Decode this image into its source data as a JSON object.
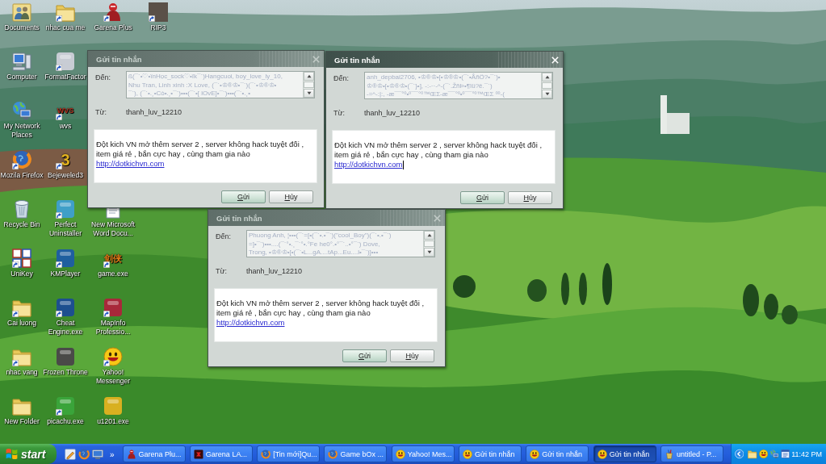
{
  "desktop": {
    "columns": [
      {
        "upper": [
          {
            "label": "Documents",
            "kind": "people-folder",
            "shortcut": false
          },
          {
            "label": "Computer",
            "kind": "computer",
            "shortcut": false
          },
          {
            "label": "My Network Places",
            "kind": "network",
            "shortcut": false
          },
          {
            "label": "Mozila Firefox",
            "kind": "globe",
            "shortcut": true
          },
          {
            "label": "Recycle Bin",
            "kind": "bin",
            "shortcut": false
          },
          {
            "label": "UniKey",
            "kind": "grid",
            "shortcut": true
          },
          {
            "label": "Cai luong",
            "kind": "folder",
            "shortcut": true
          },
          {
            "label": "nhac vang",
            "kind": "folder",
            "shortcut": true
          },
          {
            "label": "New Folder",
            "kind": "folder",
            "shortcut": false
          }
        ]
      },
      {
        "upper": [
          {
            "label": "nhac cua me",
            "kind": "folder",
            "shortcut": true
          },
          {
            "label": "FormatFactor",
            "kind": "app",
            "color": "#c8ccd4",
            "shortcut": true
          },
          {
            "label": "wvs",
            "kind": "glyph",
            "glyph": "WVS",
            "color": "#b0301e",
            "shortcut": true
          },
          {
            "label": "Bejeweled3",
            "kind": "glyph",
            "glyph": "3",
            "color": "#e0b020",
            "shortcut": true
          },
          {
            "label": "Perfect Uninstaller",
            "kind": "app",
            "color": "#3f9fc8",
            "shortcut": true
          },
          {
            "label": "KMPlayer",
            "kind": "app",
            "color": "#1f5f9f",
            "shortcut": true
          },
          {
            "label": "Cheat Engine.exe",
            "kind": "app",
            "color": "#1d4f8f",
            "shortcut": true
          },
          {
            "label": "Frozen Throne",
            "kind": "app",
            "color": "#4a4a48",
            "shortcut": false
          },
          {
            "label": "picachu.exe",
            "kind": "app",
            "color": "#3aa43a",
            "shortcut": true
          }
        ]
      },
      {
        "upper": [
          {
            "label": "Garena Plus",
            "kind": "figure",
            "shortcut": true
          }
        ],
        "lower": [
          {
            "label": "New Microsoft Word Docu...",
            "kind": "document",
            "shortcut": false
          },
          {
            "label": "game.exe",
            "kind": "glyph",
            "glyph": "剑侠",
            "color": "#e07818",
            "shortcut": true
          },
          {
            "label": "MapInfo Professio...",
            "kind": "app",
            "color": "#a8283a",
            "shortcut": true
          },
          {
            "label": "Yahoo! Messenger",
            "kind": "smiley",
            "shortcut": true
          },
          {
            "label": "u1201.exe",
            "kind": "app",
            "color": "#d8b020",
            "shortcut": false
          }
        ]
      },
      {
        "upper": [
          {
            "label": "RIP3",
            "kind": "photo",
            "shortcut": true
          }
        ]
      }
    ]
  },
  "windows": [
    {
      "title": "Gửi tin nhắn",
      "active": false,
      "to_label": "Đến:",
      "recipients": {
        "text": "ß(¯`•♡•ïnHọc_sock♡•ïk¯`)Hangcuoi, boy_love_ly_10,\nNhu Tran, Linh xinh :X Love, (¯`•♔®♔•¯`)(¯`•♔®♔•\n¯`), (¯`•.¸•Cò•.¸•¯`)•••(¯`•[ lOvE]•¯`)•••(¯`•.¸•",
        "disabled": true
      },
      "from_label": "Từ:",
      "sender": "thanh_luv_12210",
      "message": "Đột kich VN mở thêm server 2 , server không hack tuyệt đối ,\nitem giá rẻ , bắn cực hay , cùng tham gia nào",
      "link": "http://dotkichvn.com",
      "caret": false,
      "buttons": [
        {
          "label": "Gửi",
          "default": true
        },
        {
          "label": "Hủy",
          "default": false
        }
      ]
    },
    {
      "title": "Gửi tin nhắn",
      "active": true,
      "to_label": "Đến:",
      "recipients": {
        "text": "anh_depbai2706, •♔®♔•[•♔®♔•(¯`•ÅñÖ?•¯`)•\n♔®♔•[•♔®♔•(¯`}•], -:-··-^-(¯`.ŽñÞ•¶ïü?ë.¯`)\n-=^-:|:, -æ¯¯°º•º¯¯°º™ŒΣ-æ¯¯°º•º¯¯°º™ŒΣ ºº-(",
        "disabled": true
      },
      "from_label": "Từ:",
      "sender": "thanh_luv_12210",
      "message": "Đột kich VN mở thêm server 2 , server không hack tuyệt đối ,\nitem giá rẻ , bắn cực hay , cùng tham gia nào",
      "link": "http://dotkichvn.com",
      "caret": true,
      "buttons": [
        {
          "label": "Gửi",
          "default": true
        },
        {
          "label": "Hủy",
          "default": false
        }
      ]
    },
    {
      "title": "Gửi tin nhắn",
      "active": false,
      "to_label": "Đến:",
      "recipients": {
        "text": "Phuong Anh, ¦•••(¯`=[•(¯`•.•¯`)(\"cool_Boy\")(¯`•.•¯`)\n=]•¯`)•••....(¯`°•.¸¯`°•.°Fe he0°.•°¯`..•°¯`) Dove,\nTrong, •♔®♔•[•(¯`•L...gA....tAp...Eu....l•¯`)]•••",
        "disabled": true
      },
      "from_label": "Từ:",
      "sender": "thanh_luv_12210",
      "message": "Đột kich VN mở thêm server 2 , server không hack tuyệt đối ,\nitem giá rẻ , bắn cực hay , cùng tham gia nào",
      "link": "http://dotkichvn.com",
      "caret": false,
      "buttons": [
        {
          "label": "Gửi",
          "default": true
        },
        {
          "label": "Hủy",
          "default": false
        }
      ]
    }
  ],
  "taskbar": {
    "start": "start",
    "quick_launch": [
      {
        "kind": "pencil"
      },
      {
        "kind": "globe"
      },
      {
        "kind": "monitor"
      }
    ],
    "overflow": "»",
    "tasks": [
      {
        "label": "Garena Plu...",
        "kind": "figure",
        "selected": false
      },
      {
        "label": "Garena LA...",
        "kind": "game",
        "selected": false
      },
      {
        "label": "[Tin mới]Qu...",
        "kind": "globe",
        "selected": false
      },
      {
        "label": "Game bOx ...",
        "kind": "globe",
        "selected": false
      },
      {
        "label": "Yahoo! Mes...",
        "kind": "smiley",
        "selected": false
      },
      {
        "label": "Gửi tin nhắn",
        "kind": "smiley",
        "selected": false
      },
      {
        "label": "Gửi tin nhắn",
        "kind": "smiley",
        "selected": false
      },
      {
        "label": "Gửi tin nhắn",
        "kind": "smiley",
        "selected": true
      },
      {
        "label": "untitled - P...",
        "kind": "paint",
        "selected": false
      }
    ],
    "tray": {
      "icons": [
        {
          "kind": "folder"
        },
        {
          "kind": "smiley"
        },
        {
          "kind": "network"
        },
        {
          "kind": "window"
        }
      ],
      "clock": "11:42 PM"
    }
  }
}
